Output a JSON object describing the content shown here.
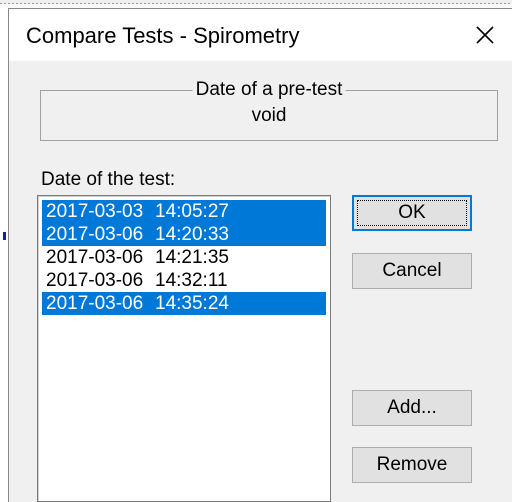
{
  "window": {
    "title": "Compare Tests - Spirometry"
  },
  "pretest": {
    "legend": "Date of a pre-test",
    "value": "void"
  },
  "tests": {
    "label": "Date of the test:",
    "items": [
      {
        "date": "2017-03-03",
        "time": "14:05:27",
        "selected": true
      },
      {
        "date": "2017-03-06",
        "time": "14:20:33",
        "selected": true
      },
      {
        "date": "2017-03-06",
        "time": "14:21:35",
        "selected": false
      },
      {
        "date": "2017-03-06",
        "time": "14:32:11",
        "selected": false
      },
      {
        "date": "2017-03-06",
        "time": "14:35:24",
        "selected": true
      }
    ]
  },
  "buttons": {
    "ok": "OK",
    "cancel": "Cancel",
    "add": "Add...",
    "remove": "Remove"
  },
  "icons": {
    "close": "close-icon"
  },
  "colors": {
    "selection": "#0078d7",
    "dialog_bg": "#f0f0f0"
  }
}
